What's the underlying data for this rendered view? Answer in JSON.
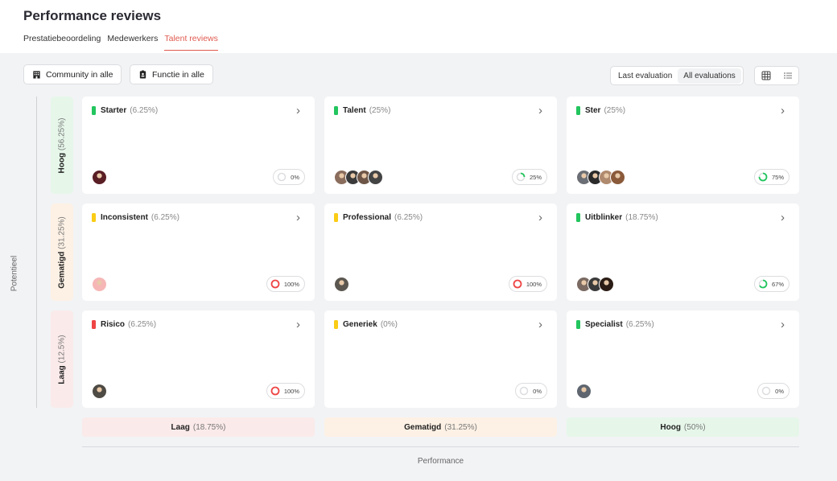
{
  "page": {
    "title": "Performance reviews"
  },
  "tabs": [
    {
      "label": "Prestatiebeoordeling"
    },
    {
      "label": "Medewerkers"
    },
    {
      "label": "Talent reviews"
    }
  ],
  "filters": {
    "community_label": "Community in alle",
    "function_label": "Functie in alle"
  },
  "evaluation_toggle": {
    "last": "Last evaluation",
    "all": "All evaluations"
  },
  "axes": {
    "potential": "Potentieel",
    "performance": "Performance"
  },
  "rows": [
    {
      "label": "Hoog",
      "pct": "(56.25%)",
      "color": "#e6f7ea"
    },
    {
      "label": "Gematigd",
      "pct": "(31.25%)",
      "color": "#fdf1e5"
    },
    {
      "label": "Laag",
      "pct": "(12.5%)",
      "color": "#fbeaea"
    }
  ],
  "columns": [
    {
      "label": "Laag",
      "pct": "(18.75%)",
      "color": "#fbeaea"
    },
    {
      "label": "Gematigd",
      "pct": "(31.25%)",
      "color": "#fdf1e5"
    },
    {
      "label": "Hoog",
      "pct": "(50%)",
      "color": "#e6f7ea"
    }
  ],
  "cells": [
    {
      "title": "Starter",
      "pct": "(6.25%)",
      "status_color": "#22c55e",
      "progress": "0%",
      "progress_value": 0,
      "ring_color": "#d0d0d4",
      "avatars": 1
    },
    {
      "title": "Talent",
      "pct": "(25%)",
      "status_color": "#22c55e",
      "progress": "25%",
      "progress_value": 0.25,
      "ring_color": "#22c55e",
      "avatars": 4
    },
    {
      "title": "Ster",
      "pct": "(25%)",
      "status_color": "#22c55e",
      "progress": "75%",
      "progress_value": 0.75,
      "ring_color": "#22c55e",
      "avatars": 4
    },
    {
      "title": "Inconsistent",
      "pct": "(6.25%)",
      "status_color": "#facc15",
      "progress": "100%",
      "progress_value": 1,
      "ring_color": "#ef4444",
      "avatars": 1
    },
    {
      "title": "Professional",
      "pct": "(6.25%)",
      "status_color": "#facc15",
      "progress": "100%",
      "progress_value": 1,
      "ring_color": "#ef4444",
      "avatars": 1
    },
    {
      "title": "Uitblinker",
      "pct": "(18.75%)",
      "status_color": "#22c55e",
      "progress": "67%",
      "progress_value": 0.67,
      "ring_color": "#22c55e",
      "avatars": 3
    },
    {
      "title": "Risico",
      "pct": "(6.25%)",
      "status_color": "#ef4444",
      "progress": "100%",
      "progress_value": 1,
      "ring_color": "#ef4444",
      "avatars": 1
    },
    {
      "title": "Generiek",
      "pct": "(0%)",
      "status_color": "#facc15",
      "progress": "0%",
      "progress_value": 0,
      "ring_color": "#d0d0d4",
      "avatars": 0
    },
    {
      "title": "Specialist",
      "pct": "(6.25%)",
      "status_color": "#22c55e",
      "progress": "0%",
      "progress_value": 0,
      "ring_color": "#d0d0d4",
      "avatars": 1
    }
  ],
  "icons": {
    "community": "building-icon",
    "function": "badge-icon",
    "grid_view": "grid-icon",
    "list_view": "list-icon",
    "chevron": "chevron-right-icon"
  }
}
